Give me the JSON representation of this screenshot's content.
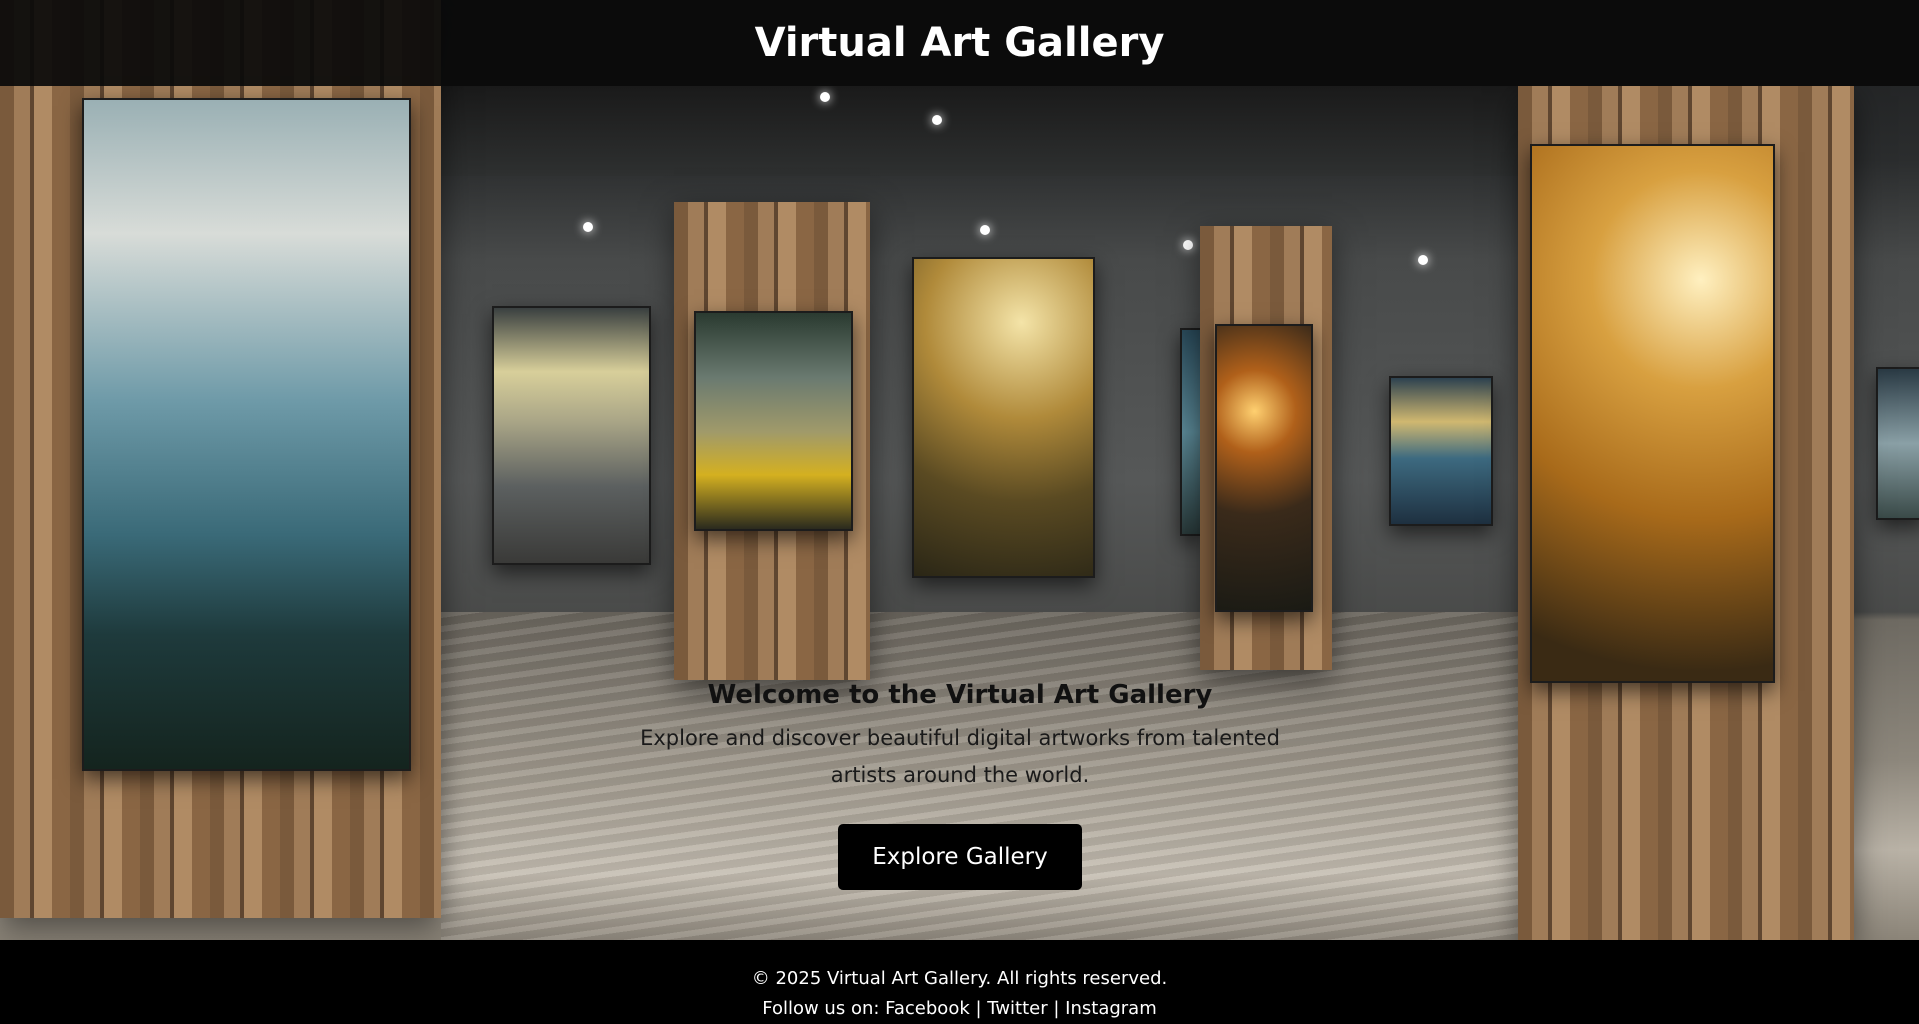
{
  "header": {
    "title": "Virtual Art Gallery"
  },
  "hero": {
    "heading": "Welcome to the Virtual Art Gallery",
    "description": "Explore and discover beautiful digital artworks from talented artists around the world.",
    "button_label": "Explore Gallery"
  },
  "footer": {
    "copyright": "© 2025 Virtual Art Gallery. All rights reserved.",
    "follow_label": "Follow us on:",
    "separator": "|",
    "links": [
      "Facebook",
      "Twitter",
      "Instagram"
    ]
  }
}
